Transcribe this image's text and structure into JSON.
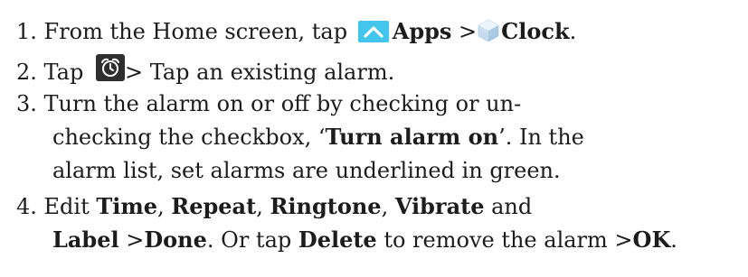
{
  "steps": [
    {
      "number": "1.",
      "prefix": " From the Home screen, tap ",
      "apps_label": "Apps",
      "separator": " >",
      "clock_label": "Clock",
      "suffix": "."
    },
    {
      "number": "2.",
      "prefix": " Tap ",
      "suffix": "> Tap an existing alarm."
    },
    {
      "number": "3.",
      "line1": " Turn the alarm on or off by checking or un-",
      "line2_a": "checking the checkbox, ‘",
      "line2_bold": "Turn alarm on",
      "line2_b": "’. In the",
      "line3": "alarm list, set alarms are underlined in green."
    },
    {
      "number": "4.",
      "line1_a": " Edit ",
      "time": "Time",
      "comma1": ", ",
      "repeat": "Repeat",
      "comma2": ", ",
      "ringtone": "Ringtone",
      "comma3": ", ",
      "vibrate": "Vibrate",
      "and": " and",
      "label": "Label",
      "gt1": " >",
      "done": "Done",
      "mid": ". Or tap ",
      "delete": "Delete",
      "tail": " to remove the alarm >",
      "ok": "OK",
      "end": "."
    }
  ],
  "icons": {
    "apps": "chevron-up-icon",
    "clock_app": "clock-app-icon",
    "alarm": "alarm-clock-icon"
  },
  "colors": {
    "apps_icon_bg": "#43c6ee",
    "alarm_icon_bg": "#2f2f2f"
  }
}
